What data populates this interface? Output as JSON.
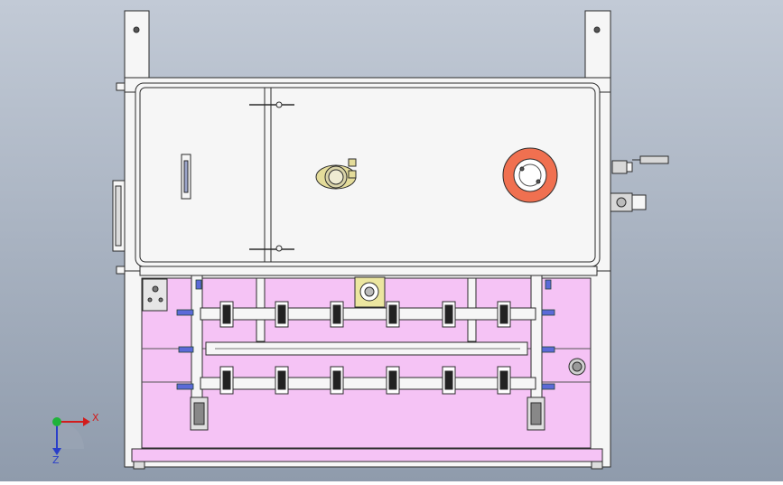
{
  "viewport": {
    "background_top": "#c2cad6",
    "background_bottom": "#8f9bac",
    "line_color": "#2b2b2b",
    "panel_color": "#f6f6f6",
    "pink_area_color": "#f5c3f5",
    "accent_orange": "#f08060",
    "accent_yellow": "#e4dc9a"
  },
  "triad": {
    "x_label": "X",
    "z_label": "Z",
    "x_color": "#d21c1c",
    "y_color": "#1fb33a",
    "z_color": "#2a3fc9"
  }
}
